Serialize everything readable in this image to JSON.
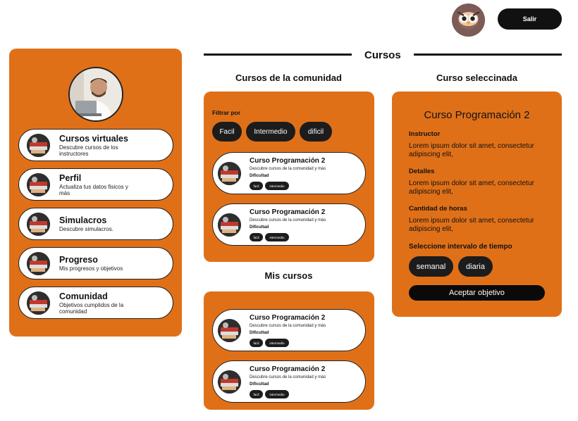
{
  "header": {
    "logout_label": "Salir",
    "logo_icon": "owl-icon"
  },
  "page": {
    "title": "Cursos"
  },
  "sidebar": {
    "avatar_icon": "user-avatar",
    "items": [
      {
        "title": "Cursos virtuales",
        "desc": "Descubre cursos de los instructores"
      },
      {
        "title": "Perfil",
        "desc": "Actualiza tus datos fisicos y más"
      },
      {
        "title": "Simulacros",
        "desc": "Descubre simulacros."
      },
      {
        "title": "Progreso",
        "desc": "Mis progresos y objetivos"
      },
      {
        "title": "Comunidad",
        "desc": "Objetivos cumplidos de la comunidad"
      }
    ]
  },
  "community": {
    "title": "Cursos de la comunidad",
    "filter_label": "Filtrar por",
    "filters": [
      "Facil",
      "Intermedio",
      "dificil"
    ],
    "courses": [
      {
        "title": "Curso Programación 2",
        "desc": "Descubre cursos de la comunidad y más",
        "difficulty_label": "Dificultad",
        "tags": [
          "facil",
          "intermedio"
        ]
      },
      {
        "title": "Curso Programación 2",
        "desc": "Descubre cursos de la comunidad y más",
        "difficulty_label": "Dificultad",
        "tags": [
          "facil",
          "intermedio"
        ]
      }
    ]
  },
  "my_courses": {
    "title": "Mis cursos",
    "courses": [
      {
        "title": "Curso Programación 2",
        "desc": "Descubre cursos de la comunidad y más",
        "difficulty_label": "Dificultad",
        "tags": [
          "facil",
          "intermedio"
        ]
      },
      {
        "title": "Curso Programación 2",
        "desc": "Descubre cursos de la comunidad y más",
        "difficulty_label": "Dificultad",
        "tags": [
          "facil",
          "intermedio"
        ]
      }
    ]
  },
  "selected": {
    "section_title": "Curso seleccinada",
    "course_title": "Curso Programación 2",
    "instructor_label": "Instructor",
    "instructor_text": "Lorem ipsum dolor sit amet, consectetur adipiscing elit,",
    "details_label": "Detalles",
    "details_text": "Lorem ipsum dolor sit amet, consectetur adipiscing elit,",
    "hours_label": "Cantidad de horas",
    "hours_text": "Lorem ipsum dolor sit amet, consectetur adipiscing elit,",
    "interval_label": "Seleccione intervalo de tiempo",
    "intervals": [
      "semanal",
      "diaria"
    ],
    "accept_label": "Aceptar objetivo"
  },
  "colors": {
    "accent": "#E07018",
    "dark": "#1c1c1c"
  }
}
